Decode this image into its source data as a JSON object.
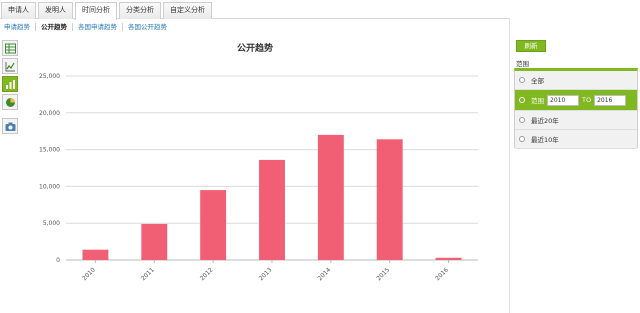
{
  "tabs": [
    {
      "label": "申请人"
    },
    {
      "label": "发明人"
    },
    {
      "label": "时间分析"
    },
    {
      "label": "分类分析"
    },
    {
      "label": "自定义分析"
    }
  ],
  "subtabs": [
    {
      "label": "申请趋势"
    },
    {
      "label": "公开趋势"
    },
    {
      "label": "各国申请趋势"
    },
    {
      "label": "各国公开趋势"
    }
  ],
  "toolbar": {
    "icons": [
      "table-icon",
      "line-chart-icon",
      "bar-chart-icon",
      "pie-chart-icon",
      "camera-icon"
    ]
  },
  "right_panel": {
    "refresh_label": "刷新",
    "range_label": "范围",
    "options": {
      "all": "全部",
      "range_label": "范围",
      "range_from": "2010",
      "range_to_label": "TO",
      "range_to": "2016",
      "last20": "最近20年",
      "last10": "最近10年"
    }
  },
  "colors": {
    "bar": "#f05f73",
    "accent": "#7fb81f",
    "link": "#2a7ab8"
  },
  "chart_data": {
    "type": "bar",
    "title": "公开趋势",
    "categories": [
      "2010",
      "2011",
      "2012",
      "2013",
      "2014",
      "2015",
      "2016"
    ],
    "values": [
      1400,
      4900,
      9500,
      13600,
      17000,
      16400,
      300
    ],
    "ylim": [
      0,
      25000
    ],
    "yticks": [
      0,
      5000,
      10000,
      15000,
      20000,
      25000
    ],
    "ytick_labels": [
      "0",
      "5,000",
      "10,000",
      "15,000",
      "20,000",
      "25,000"
    ],
    "grid": true
  }
}
